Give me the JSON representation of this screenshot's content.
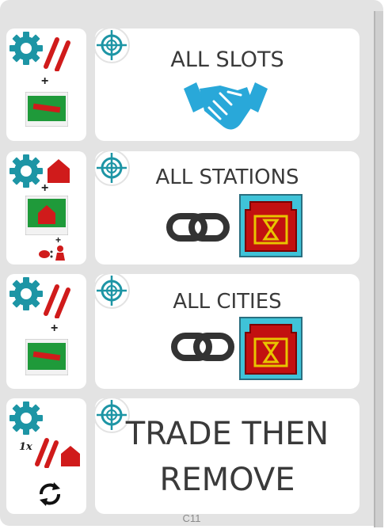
{
  "rows": [
    {
      "label": "ALL SLOTS",
      "result_icon": "handshake-icon"
    },
    {
      "label": "ALL STATIONS",
      "result_icon": "link-icon",
      "extra_icon": "hourglass-card-icon"
    },
    {
      "label": "ALL CITIES",
      "result_icon": "link-icon",
      "extra_icon": "hourglass-card-icon"
    },
    {
      "label_line1": "TRADE THEN",
      "label_line2": "REMOVE"
    }
  ],
  "left_symbols": {
    "plus": "+",
    "row2_sub": "+",
    "row4_multiplier": "1x"
  },
  "footer": {
    "code": "C11"
  },
  "colors": {
    "teal": "#1d95a5",
    "red": "#d01b1b",
    "green": "#1f9a3a",
    "handshake": "#29a8d9",
    "card_bg": "#e3e3e3"
  }
}
